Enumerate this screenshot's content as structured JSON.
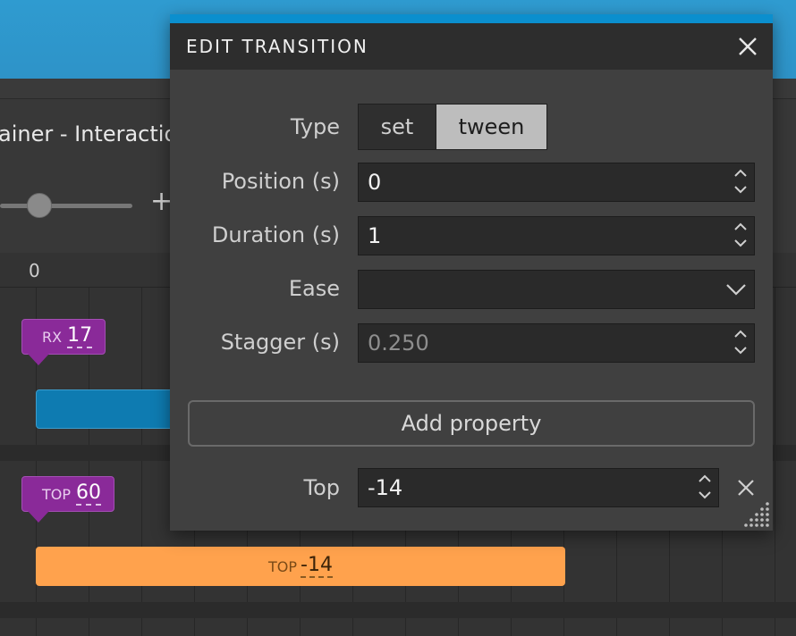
{
  "background": {
    "panel_title": "ainer - Interactio",
    "zoom_plus": "+",
    "ruler_zero": "0",
    "tracks": [
      {
        "marker_label": "RX",
        "marker_value": "17"
      },
      {
        "marker_label": "TOP",
        "marker_value": "60",
        "bar_label": "TOP",
        "bar_value": "-14"
      }
    ]
  },
  "dialog": {
    "title": "EDIT TRANSITION",
    "type_label": "Type",
    "type_options": [
      "set",
      "tween"
    ],
    "type_selected": "tween",
    "position_label": "Position (s)",
    "position_value": "0",
    "duration_label": "Duration (s)",
    "duration_value": "1",
    "ease_label": "Ease",
    "ease_value": "",
    "stagger_label": "Stagger (s)",
    "stagger_value": "0.250",
    "add_property_label": "Add property",
    "properties": [
      {
        "label": "Top",
        "value": "-14"
      }
    ]
  },
  "colors": {
    "accent": "#0b8fce",
    "marker": "#8a2a99",
    "bar_blue": "#0e7bb1",
    "bar_orange": "#ffa24d"
  },
  "icons": [
    "close-icon",
    "spinner-up-icon",
    "spinner-down-icon",
    "chevron-down-icon",
    "resize-grip-icon",
    "remove-property-icon"
  ]
}
